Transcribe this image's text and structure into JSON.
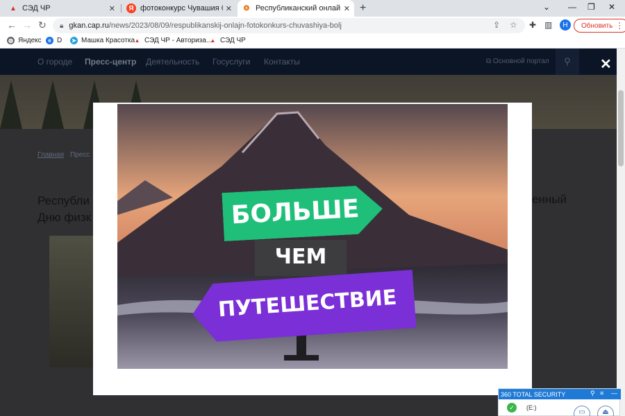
{
  "tabs": [
    {
      "title": "СЭД ЧР",
      "favicon_letter": "▲",
      "favicon_color": "#d93025",
      "active": false
    },
    {
      "title": "фотоконкурс Чувашия больше",
      "favicon_letter": "Я",
      "favicon_color": "#fc3f1d",
      "active": false
    },
    {
      "title": "Республиканский онлайн-фото",
      "favicon_letter": "❂",
      "favicon_color": "#e8710a",
      "active": true
    }
  ],
  "toolbar": {
    "url_host": "gkan.cap.ru",
    "url_path": "/news/2023/08/09/respublikanskij-onlajn-fotokonkurs-chuvashiya-bolj",
    "profile_initial": "Н",
    "update_label": "Обновить"
  },
  "bookmarks": [
    {
      "label": "Яндекс",
      "icon_color": "#202124"
    },
    {
      "label": "D",
      "icon_color": "#1a73e8"
    },
    {
      "label": "Машка Красотка",
      "icon_color": "#2aa1da"
    },
    {
      "label": "СЭД ЧР - Авториза...",
      "icon_color": "#d93025"
    },
    {
      "label": "СЭД ЧР",
      "icon_color": "#d93025"
    }
  ],
  "site_nav": {
    "items": [
      "О городе",
      "Пресс-центр",
      "Деятельность",
      "Госуслуги",
      "Контакты"
    ],
    "portal_link": "Основной портал"
  },
  "page": {
    "breadcrumb_home": "Главная",
    "breadcrumb_section": "Пресс",
    "headline_line1": "Республи",
    "headline_line2": "Дню физк",
    "headline_right": "енный"
  },
  "photo_signs": {
    "sign1": "БОЛЬШЕ",
    "sign2": "ЧЕМ",
    "sign3": "ПУТЕШЕСТВИЕ",
    "sign1_color": "#1fbf7a",
    "sign2_color": "#3d3d3f",
    "sign3_color": "#7b2fd6"
  },
  "widget": {
    "title": "360 TOTAL SECURITY",
    "drive": "(E:)"
  }
}
